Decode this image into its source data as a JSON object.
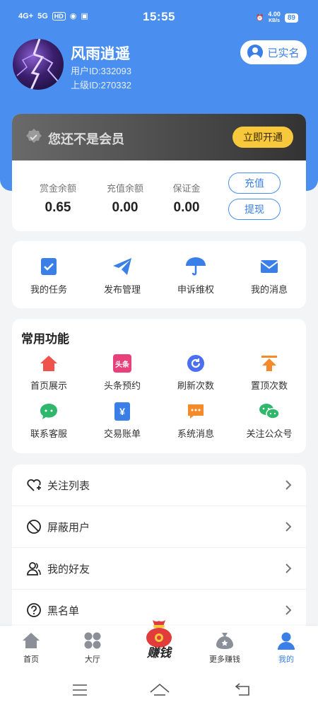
{
  "status_bar": {
    "signal1": "4G+",
    "signal2": "5G",
    "hd": "HD",
    "time": "15:55",
    "net_speed": "4.00",
    "net_unit": "KB/s",
    "battery": "89"
  },
  "profile": {
    "name": "风雨逍遥",
    "user_id": "用户ID:332093",
    "parent_id": "上级ID:270332",
    "verified_label": "已实名"
  },
  "member": {
    "notice": "您还不是会员",
    "open_button": "立即开通"
  },
  "balances": [
    {
      "label": "赏金余额",
      "value": "0.65"
    },
    {
      "label": "充值余额",
      "value": "0.00"
    },
    {
      "label": "保证金",
      "value": "0.00"
    }
  ],
  "actions": {
    "recharge": "充值",
    "withdraw": "提现"
  },
  "quick": [
    {
      "label": "我的任务",
      "icon": "task-icon"
    },
    {
      "label": "发布管理",
      "icon": "paper-plane-icon"
    },
    {
      "label": "申诉维权",
      "icon": "umbrella-icon"
    },
    {
      "label": "我的消息",
      "icon": "mail-icon"
    }
  ],
  "common": {
    "title": "常用功能",
    "items": [
      {
        "label": "首页展示",
        "icon": "home-icon",
        "color": "#f0524c"
      },
      {
        "label": "头条预约",
        "icon": "headline-icon",
        "icon_text": "头条",
        "color": "#e8407a"
      },
      {
        "label": "刷新次数",
        "icon": "refresh-icon",
        "color": "#4a6ff0"
      },
      {
        "label": "置顶次数",
        "icon": "pin-top-icon",
        "color": "#f58a2a"
      },
      {
        "label": "联系客服",
        "icon": "chat-icon",
        "color": "#2fb86b"
      },
      {
        "label": "交易账单",
        "icon": "bill-icon",
        "icon_text": "¥",
        "color": "#3a7fe8"
      },
      {
        "label": "系统消息",
        "icon": "message-icon",
        "color": "#f58a2a"
      },
      {
        "label": "关注公众号",
        "icon": "wechat-icon",
        "color": "#2fb86b"
      }
    ]
  },
  "list": [
    {
      "label": "关注列表",
      "icon": "heart-plus-icon"
    },
    {
      "label": "屏蔽用户",
      "icon": "block-icon"
    },
    {
      "label": "我的好友",
      "icon": "friends-icon"
    },
    {
      "label": "黑名单",
      "icon": "question-icon"
    }
  ],
  "nav": [
    {
      "label": "首页",
      "icon": "home-icon"
    },
    {
      "label": "大厅",
      "icon": "grid-icon"
    },
    {
      "label": "赚钱",
      "icon": "money-bag-icon"
    },
    {
      "label": "更多赚钱",
      "icon": "coin-bag-icon"
    },
    {
      "label": "我的",
      "icon": "user-icon",
      "active": true
    }
  ],
  "colors": {
    "primary": "#4a8ff0",
    "gold": "#f7c83b"
  }
}
